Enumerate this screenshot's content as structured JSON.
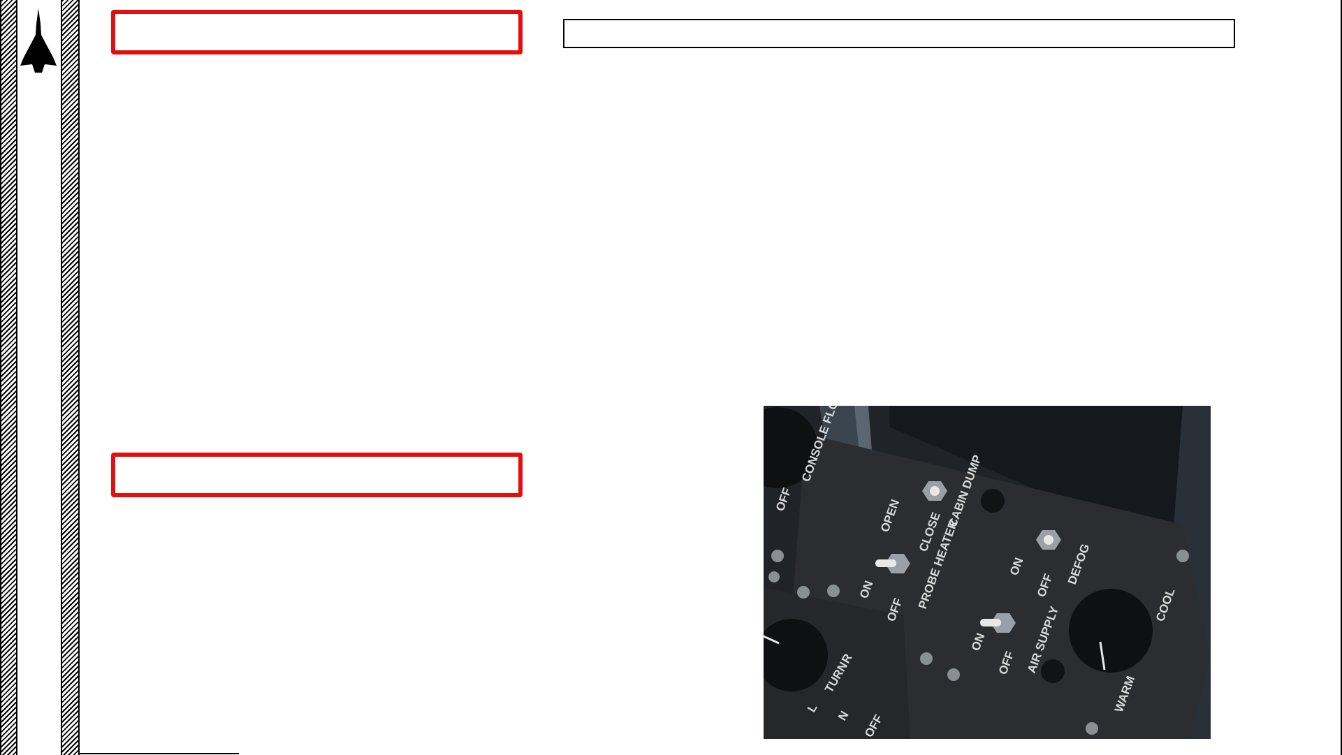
{
  "page": {
    "title_box_1": "",
    "title_box_2": "",
    "header_box": ""
  },
  "logo": {
    "icon": "fighter-jet-silhouette-icon"
  },
  "panel_photo": {
    "labels": {
      "console_flood": "CONSOLE FLOOD",
      "console_off": "OFF",
      "open": "OPEN",
      "close": "CLOSE",
      "cabin_dump": "CABIN DUMP",
      "probe_on": "ON",
      "probe_off": "OFF",
      "probe_heater": "PROBE HEATER",
      "defog_on": "ON",
      "defog_off": "OFF",
      "defog": "DEFOG",
      "air_on": "ON",
      "air_off": "OFF",
      "air_supply": "AIR SUPPLY",
      "warm": "WARM",
      "cool": "COOL",
      "turn": "TURN",
      "turn_r": "R",
      "turn_l": "L",
      "lower_n": "N",
      "lower_off": "OFF"
    }
  }
}
